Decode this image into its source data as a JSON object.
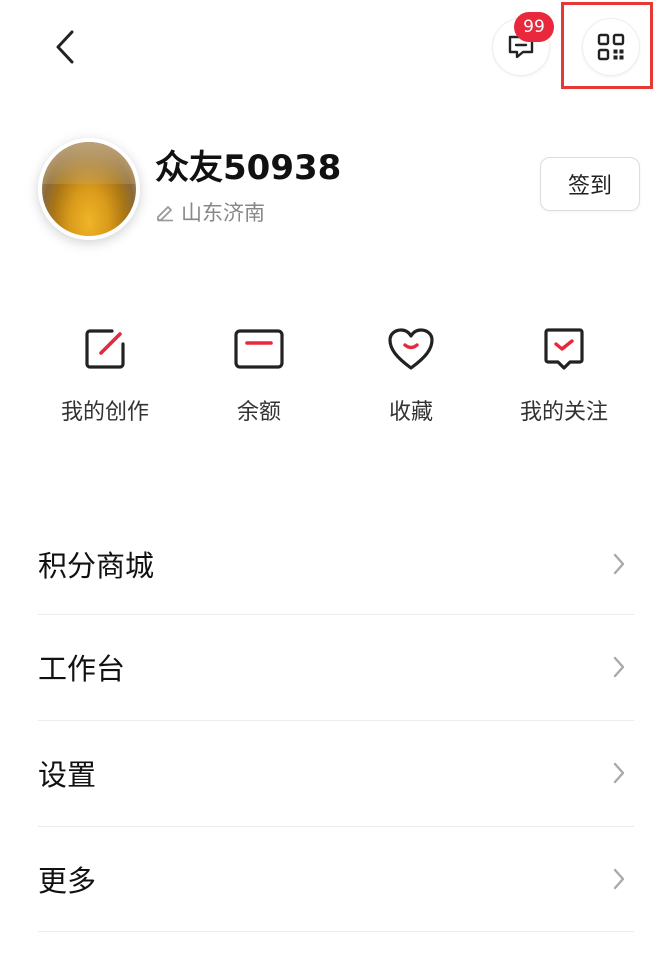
{
  "topbar": {
    "back_icon": "chevron-left-icon",
    "message_icon": "message-icon",
    "message_badge": "99",
    "qr_icon": "qr-code-icon",
    "badge_color": "#e8283c",
    "highlight_color": "#e53935"
  },
  "profile": {
    "username": "众友50938",
    "location": "山东济南",
    "location_icon": "pencil-icon",
    "signin_label": "签到"
  },
  "quick_actions": [
    {
      "label": "我的创作",
      "icon": "edit-square-icon"
    },
    {
      "label": "余额",
      "icon": "wallet-card-icon"
    },
    {
      "label": "收藏",
      "icon": "heart-icon"
    },
    {
      "label": "我的关注",
      "icon": "follow-flag-icon"
    }
  ],
  "menu": [
    {
      "label": "积分商城"
    },
    {
      "label": "工作台"
    },
    {
      "label": "设置"
    },
    {
      "label": "更多"
    }
  ],
  "colors": {
    "accent": "#e8283c",
    "text": "#111111",
    "muted": "#888888"
  }
}
